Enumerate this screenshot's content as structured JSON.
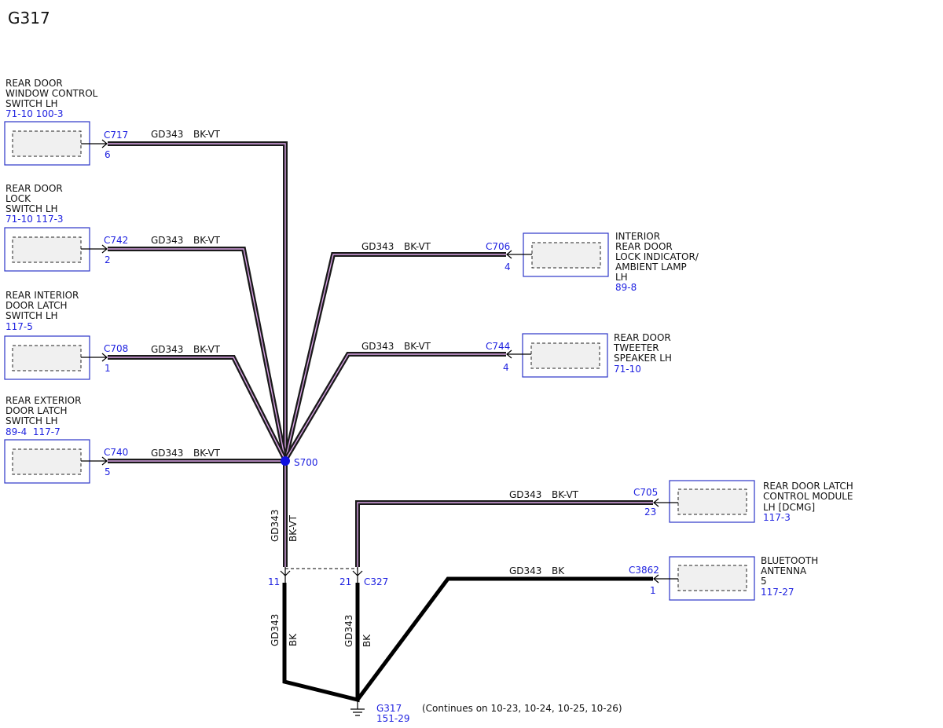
{
  "title": "G317",
  "components": {
    "window_switch": {
      "lines": [
        "REAR DOOR",
        "WINDOW CONTROL",
        "SWITCH LH"
      ],
      "ref": "71-10 100-3"
    },
    "lock_switch": {
      "lines": [
        "REAR DOOR",
        "LOCK",
        "SWITCH LH"
      ],
      "ref": "71-10 117-3"
    },
    "int_latch": {
      "lines": [
        "REAR INTERIOR",
        "DOOR LATCH",
        "SWITCH LH"
      ],
      "ref": "117-5"
    },
    "ext_latch": {
      "lines": [
        "REAR EXTERIOR",
        "DOOR LATCH",
        "SWITCH LH"
      ],
      "ref": "89-4  117-7"
    },
    "lock_indicator": {
      "lines": [
        "INTERIOR",
        "REAR DOOR",
        "LOCK INDICATOR/",
        "AMBIENT LAMP",
        "LH"
      ],
      "ref": "89-8"
    },
    "tweeter": {
      "lines": [
        "REAR DOOR",
        "TWEETER",
        "SPEAKER LH"
      ],
      "ref": "71-10"
    },
    "latch_module": {
      "lines": [
        "REAR DOOR LATCH",
        "CONTROL MODULE",
        "LH [DCMG]"
      ],
      "ref": "117-3"
    },
    "bluetooth": {
      "lines": [
        "BLUETOOTH",
        "ANTENNA",
        "5"
      ],
      "ref": "117-27"
    }
  },
  "connectors": {
    "c717": {
      "id": "C717",
      "pin": "6"
    },
    "c742": {
      "id": "C742",
      "pin": "2"
    },
    "c708": {
      "id": "C708",
      "pin": "1"
    },
    "c740": {
      "id": "C740",
      "pin": "5"
    },
    "c706": {
      "id": "C706",
      "pin": "4"
    },
    "c744": {
      "id": "C744",
      "pin": "4"
    },
    "c705": {
      "id": "C705",
      "pin": "23"
    },
    "c3862": {
      "id": "C3862",
      "pin": "1"
    },
    "c327": {
      "id": "C327",
      "pin_a": "11",
      "pin_b": "21"
    }
  },
  "wires": {
    "circuit": "GD343",
    "color_bkvt": "BK-VT",
    "color_bk": "BK"
  },
  "splice": {
    "id": "S700"
  },
  "ground": {
    "id": "G317",
    "ref": "151-29",
    "note": "(Continues on 10-23, 10-24, 10-25, 10-26)"
  },
  "colors": {
    "component_border": "#2c35c8",
    "ref_text": "#1f22e0",
    "wire_stripe": "#d9a3e6",
    "splice": "#1010e0"
  }
}
